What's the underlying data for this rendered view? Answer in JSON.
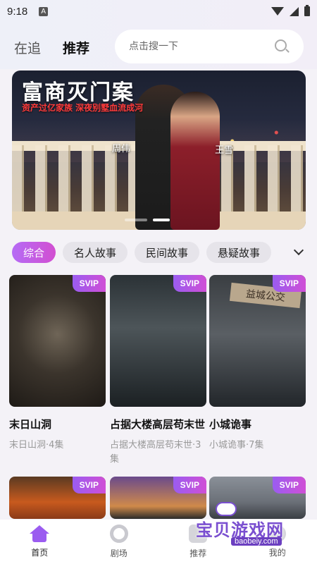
{
  "status_bar": {
    "time": "9:18",
    "a_badge": "A"
  },
  "header": {
    "tabs": [
      {
        "label": "在追",
        "active": false
      },
      {
        "label": "推荐",
        "active": true
      }
    ],
    "search": {
      "placeholder": "点击搜一下"
    }
  },
  "banner": {
    "title": "富商灭门案",
    "subtitle": "资产过亿家族 深夜别墅血流成河",
    "actors": [
      "周伟",
      "王雪"
    ],
    "indicator": {
      "total": 2,
      "active_index": 1
    }
  },
  "categories": {
    "items": [
      "综合",
      "名人故事",
      "民间故事",
      "悬疑故事"
    ],
    "active_index": 0,
    "expand_icon": "chevron-down-icon"
  },
  "cards": [
    {
      "badge": "SVIP",
      "title": "末日山洞",
      "sub": "末日山洞·4集"
    },
    {
      "badge": "SVIP",
      "title": "占据大楼高层苟末世",
      "sub": "占据大楼高层苟末世·3集"
    },
    {
      "badge": "SVIP",
      "title": "小城诡事",
      "sub": "小城诡事·7集",
      "poster_sign": "益城公交"
    },
    {
      "badge": "SVIP"
    },
    {
      "badge": "SVIP"
    },
    {
      "badge": "SVIP"
    }
  ],
  "bottom_nav": [
    {
      "label": "首页",
      "icon": "home-icon",
      "active": true
    },
    {
      "label": "剧场",
      "icon": "theater-icon",
      "active": false
    },
    {
      "label": "推荐",
      "icon": "recommend-icon",
      "active": false
    },
    {
      "label": "我的",
      "icon": "me-icon",
      "active": false
    }
  ],
  "watermark": {
    "text": "宝贝游戏网",
    "url": "baobeiy.com"
  },
  "colors": {
    "accent": "#9b5cf0",
    "svip_gradient_start": "#9a5cf0",
    "svip_gradient_end": "#d04fd6",
    "title_red": "#ff3b3b"
  }
}
